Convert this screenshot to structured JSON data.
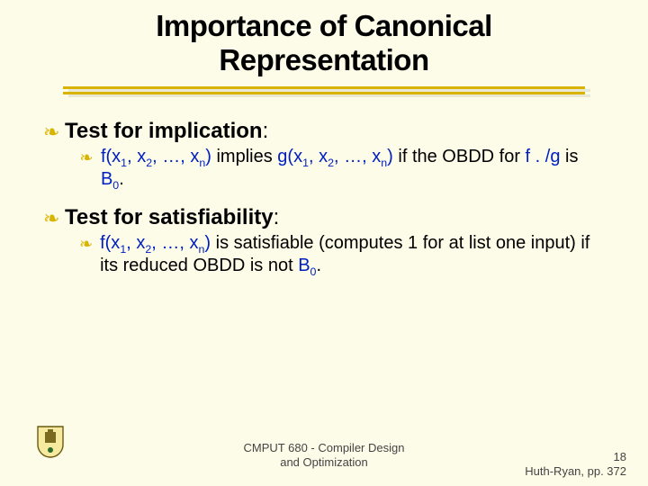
{
  "title_l1": "Importance of Canonical",
  "title_l2": "Representation",
  "items": [
    {
      "heading": "Test for implication",
      "fcall": "f(x",
      "gcall": "g(x",
      "sub_middle": " implies ",
      "sub_tail_1": " if the OBDD for ",
      "f_dot": "f . /g",
      "sub_tail_2": " is ",
      "b0": "B",
      "zero": "0",
      "period": "."
    },
    {
      "heading": "Test for satisfiability",
      "fcall": "f(x",
      "sub_tail_1": " is satisfiable (computes 1 for at list one input) if its reduced OBDD is not ",
      "b0": "B",
      "zero": "0",
      "period": "."
    }
  ],
  "args": {
    "one": "1",
    "two": "2",
    "dots": ", …, ",
    "n": "n",
    "close": ")",
    "comma": ", x"
  },
  "colon": ":",
  "footer_center_l1": "CMPUT 680 - Compiler Design",
  "footer_center_l2": "and Optimization",
  "footer_page": "18",
  "footer_ref": "Huth-Ryan, pp. 372"
}
